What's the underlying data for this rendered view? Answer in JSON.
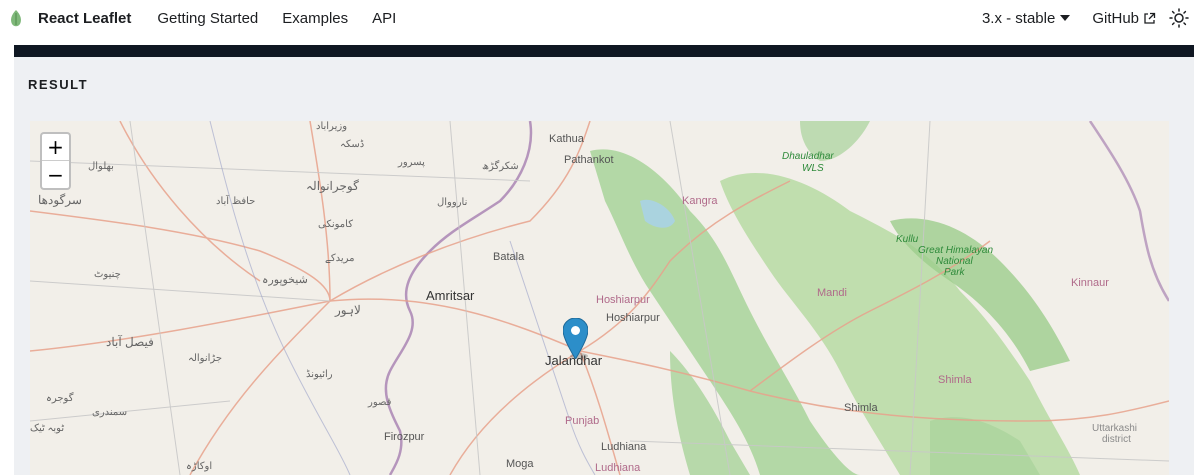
{
  "navbar": {
    "brand": "React Leaflet",
    "links": [
      "Getting Started",
      "Examples",
      "API"
    ],
    "version": "3.x - stable",
    "github": "GitHub"
  },
  "result": {
    "label": "RESULT"
  },
  "map": {
    "zoom_in": "+",
    "zoom_out": "−",
    "labels": {
      "kathua": "Kathua",
      "pathankot": "Pathankot",
      "dhauladhar": "Dhauladhar",
      "wls": "WLS",
      "kangra": "Kangra",
      "kullu": "Kullu",
      "great_himalayan": "Great Himalayan",
      "national": "National",
      "park": "Park",
      "batala": "Batala",
      "amritsar": "Amritsar",
      "hoshiarpur_pink": "Hoshiarpur",
      "hoshiarpur": "Hoshiarpur",
      "mandi": "Mandi",
      "kinnaur": "Kinnaur",
      "jalandhar": "Jalandhar",
      "shimla_pink": "Shimla",
      "shimla": "Shimla",
      "punjab": "Punjab",
      "ludhiana": "Ludhiana",
      "ludhiana_pink": "Ludhiana",
      "firozpur": "Firozpur",
      "moga": "Moga",
      "uttarkashi": "Uttarkashi",
      "district": "district",
      "u_sargodha": "سرگودھا",
      "u_gujranwala": "گوجرانوالہ",
      "u_lahore": "لاہور",
      "u_faisalabad": "فیصل آباد",
      "u_sheikhupura": "شیخوپورہ",
      "u_bhalwal": "بھلوال",
      "u_hafizabad": "حافظ آباد",
      "u_kamonki": "کامونکی",
      "u_muridke": "مریدکے",
      "u_narowal": "نارووال",
      "u_shakargarh": "شکرگڑھ",
      "u_pasrur": "پسرور",
      "u_daska": "ڈسکہ",
      "u_wazirabad": "وزیرآباد",
      "u_chiniot": "چنیوٹ",
      "u_jaranwala": "جڑانوالہ",
      "u_raiwind": "رائیونڈ",
      "u_kasur": "قصور",
      "u_gojra": "گوجرہ",
      "u_samundri": "سمندری",
      "u_tobatek": "ٹوبہ ٹیک",
      "u_okara": "اوکاڑہ"
    }
  },
  "colors": {
    "accent": "#2c8ec9",
    "code_bg": "#0f1722",
    "panel_bg": "#eef0f3",
    "map_bg": "#f2efe9",
    "forest": "#a8d39a",
    "border": "#9b6fa8",
    "road": "#e8a28c"
  },
  "icons": {
    "logo": "leaf-logo-icon",
    "caret": "caret-down-icon",
    "external": "external-link-icon",
    "theme": "sun-icon",
    "marker": "map-marker-icon"
  }
}
